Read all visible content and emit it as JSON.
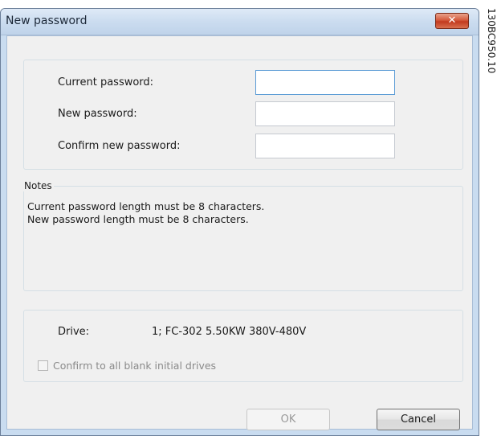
{
  "window": {
    "title": "New password",
    "close_label": "✕"
  },
  "password_fields": {
    "current_label": "Current password:",
    "current_value": "",
    "new_label": "New password:",
    "new_value": "",
    "confirm_label": "Confirm new password:",
    "confirm_value": ""
  },
  "notes": {
    "legend": "Notes",
    "lines": [
      "Current password length must be 8 characters.",
      "New password length must be 8 characters."
    ]
  },
  "drive": {
    "label": "Drive:",
    "value": "1; FC-302 5.50KW 380V-480V",
    "confirm_all_label": "Confirm to all blank initial drives",
    "confirm_all_checked": false
  },
  "buttons": {
    "ok_label": "OK",
    "cancel_label": "Cancel"
  },
  "figure_id": "130BC950.10"
}
